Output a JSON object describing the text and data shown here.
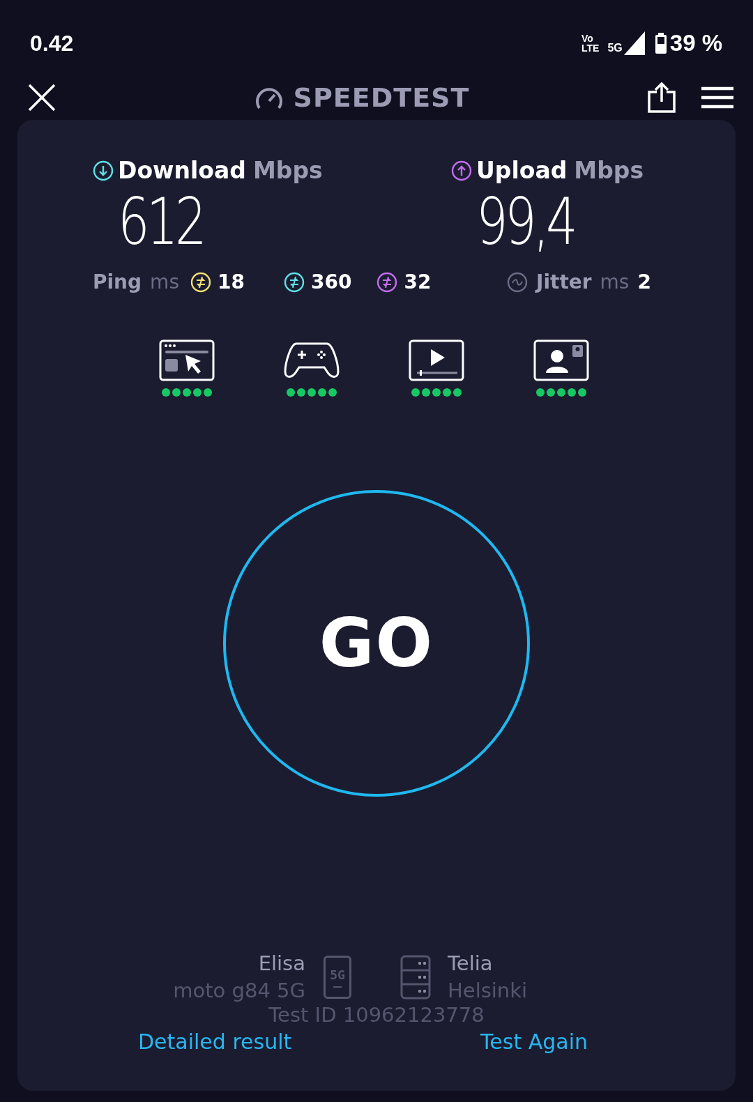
{
  "status_bar": {
    "time": "0.42",
    "volte_top": "Vo",
    "volte_bottom": "LTE",
    "network": "5G",
    "battery": "39 %"
  },
  "header": {
    "title": "SPEEDTEST"
  },
  "results": [
    {
      "kind": "download",
      "label": "Download",
      "unit": "Mbps",
      "value": "612",
      "color": "#5ee0e6"
    },
    {
      "kind": "upload",
      "label": "Upload",
      "unit": "Mbps",
      "value": "99,4",
      "color": "#c46cf0"
    }
  ],
  "ping": {
    "label": "Ping",
    "unit": "ms",
    "items": [
      {
        "value": "18",
        "color": "#f2de74"
      },
      {
        "value": "360",
        "color": "#5ee0e6"
      },
      {
        "value": "32",
        "color": "#c46cf0"
      }
    ]
  },
  "jitter": {
    "label": "Jitter",
    "unit": "ms",
    "value": "2"
  },
  "activities": [
    {
      "kind": "browsing",
      "stars": 5
    },
    {
      "kind": "gaming",
      "stars": 5
    },
    {
      "kind": "streaming",
      "stars": 5
    },
    {
      "kind": "video-call",
      "stars": 5
    }
  ],
  "go_button": {
    "label": "GO"
  },
  "provider": {
    "name": "Elisa",
    "device": "moto g84 5G",
    "badge": "5G"
  },
  "server": {
    "name": "Telia",
    "city": "Helsinki"
  },
  "test_id": "Test ID 10962123778",
  "links": [
    "Detailed result",
    "Test Again"
  ]
}
